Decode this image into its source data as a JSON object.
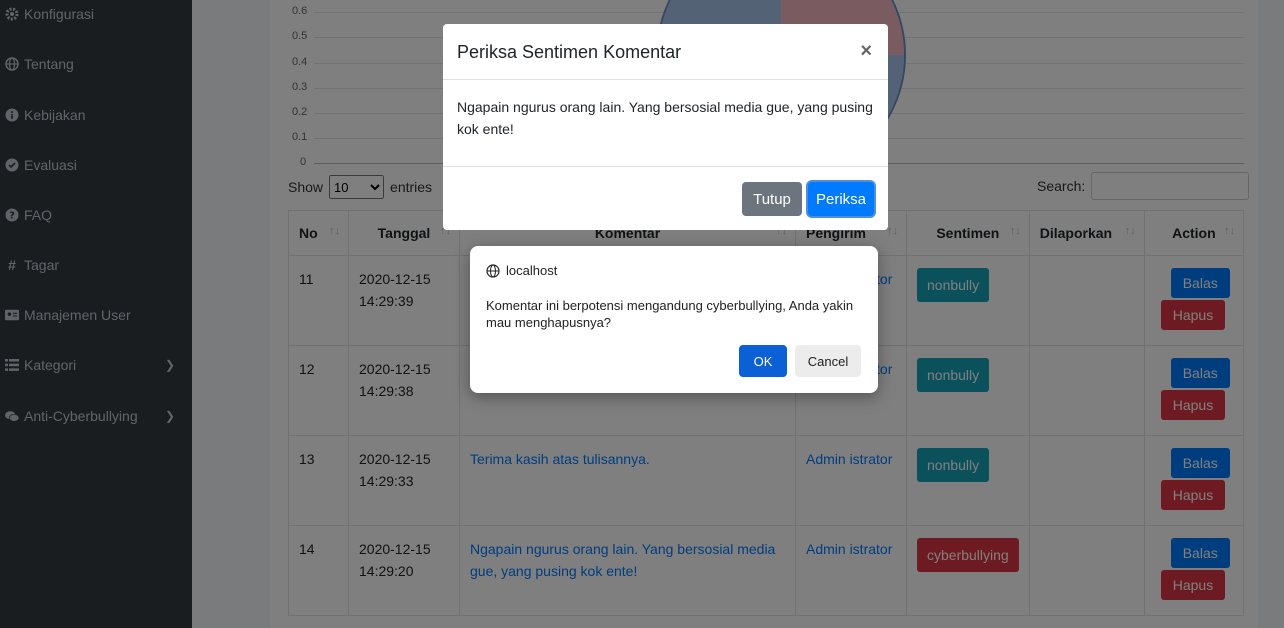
{
  "sidebar": {
    "items": [
      {
        "label": "Konfigurasi",
        "icon": "gear-icon"
      },
      {
        "label": "Tentang",
        "icon": "globe-icon"
      },
      {
        "label": "Kebijakan",
        "icon": "info-icon"
      },
      {
        "label": "Evaluasi",
        "icon": "check-circle-icon"
      },
      {
        "label": "FAQ",
        "icon": "question-icon"
      },
      {
        "label": "Tagar",
        "icon": "hashtag-icon"
      },
      {
        "label": "Manajemen User",
        "icon": "id-card-icon"
      },
      {
        "label": "Kategori",
        "icon": "list-icon",
        "chevron": true
      },
      {
        "label": "Anti-Cyberbullying",
        "icon": "comments-icon",
        "chevron": true
      }
    ]
  },
  "chart": {
    "y_ticks": [
      "0.6",
      "0.5",
      "0.4",
      "0.3",
      "0.2",
      "0.1",
      "0"
    ]
  },
  "table_controls": {
    "show_label": "Show",
    "entries_value": "10",
    "entries_label": "entries",
    "search_label": "Search:"
  },
  "table": {
    "headers": [
      "No",
      "Tanggal",
      "Komentar",
      "Pengirim",
      "Sentimen",
      "Dilaporkan",
      "Action"
    ],
    "rows": [
      {
        "no": "11",
        "date": "2020-12-15",
        "time": "14:29:39",
        "comment": "",
        "sender": "Admin istrator",
        "sentiment": "nonbully",
        "reported": "",
        "balas": "Balas",
        "hapus": "Hapus"
      },
      {
        "no": "12",
        "date": "2020-12-15",
        "time": "14:29:38",
        "comment": "",
        "sender": "Admin istrator",
        "sentiment": "nonbully",
        "reported": "",
        "balas": "Balas",
        "hapus": "Hapus"
      },
      {
        "no": "13",
        "date": "2020-12-15",
        "time": "14:29:33",
        "comment": "Terima kasih atas tulisannya.",
        "sender": "Admin istrator",
        "sentiment": "nonbully",
        "reported": "",
        "balas": "Balas",
        "hapus": "Hapus"
      },
      {
        "no": "14",
        "date": "2020-12-15",
        "time": "14:29:20",
        "comment": "Ngapain ngurus orang lain. Yang bersosial media gue, yang pusing kok ente!",
        "sender": "Admin istrator",
        "sentiment": "cyberbullying",
        "reported": "",
        "balas": "Balas",
        "hapus": "Hapus"
      }
    ]
  },
  "modal": {
    "title": "Periksa Sentimen Komentar",
    "close": "×",
    "body": "Ngapain ngurus orang lain. Yang bersosial media gue, yang pusing kok ente!",
    "btn_close": "Tutup",
    "btn_check": "Periksa"
  },
  "dialog": {
    "host": "localhost",
    "message": "Komentar ini berpotensi mengandung cyberbullying, Anda yakin mau menghapusnya?",
    "ok": "OK",
    "cancel": "Cancel"
  },
  "colors": {
    "sidebar_bg": "#343a40",
    "primary": "#007bff",
    "danger": "#dc3545",
    "info": "#17a2b8",
    "secondary": "#6c757d"
  }
}
